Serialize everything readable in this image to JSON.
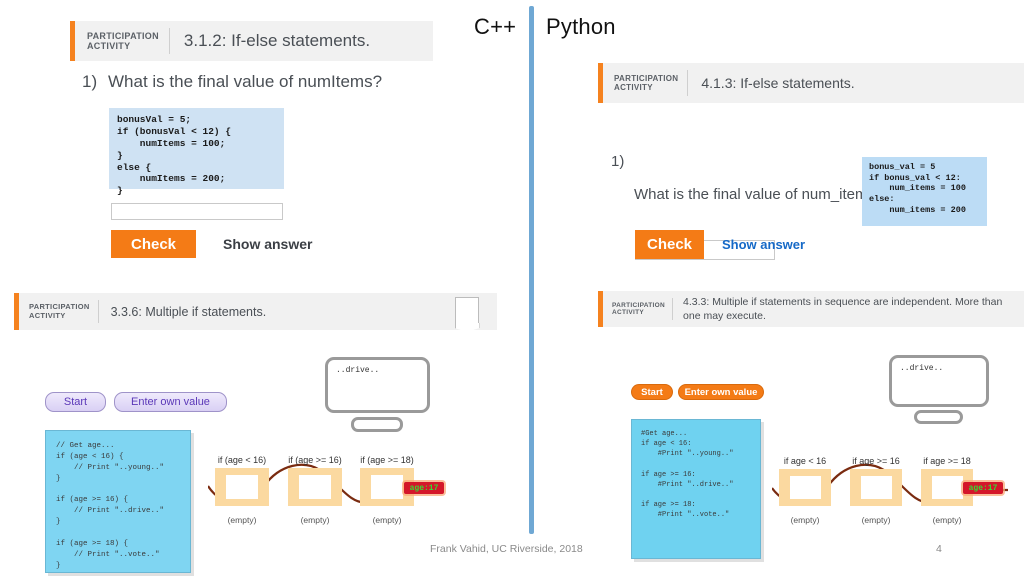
{
  "headings": {
    "left_lang": "C++",
    "right_lang": "Python"
  },
  "panel_cpp_ifelse": {
    "tag_line1": "PARTICIPATION",
    "tag_line2": "ACTIVITY",
    "title": "3.1.2: If-else statements.",
    "question_number": "1)",
    "question_text": "What is the final value of numItems?",
    "code": "bonusVal = 5;\nif (bonusVal < 12) {\n    numItems = 100;\n}\nelse {\n    numItems = 200;\n}",
    "answer_value": "",
    "answer_placeholder": "",
    "check_label": "Check",
    "show_answer_label": "Show answer"
  },
  "panel_py_ifelse": {
    "tag_line1": "PARTICIPATION",
    "tag_line2": "ACTIVITY",
    "title": "4.1.3: If-else statements.",
    "question_number": "1)",
    "question_text": "What is the final value of num_items?",
    "code": "bonus_val = 5\nif bonus_val < 12:\n    num_items = 100\nelse:\n    num_items = 200",
    "answer_value": "",
    "answer_placeholder": "",
    "check_label": "Check",
    "show_answer_label": "Show answer"
  },
  "panel_cpp_multi_if": {
    "tag_line1": "PARTICIPATION",
    "tag_line2": "ACTIVITY",
    "title": "3.3.6: Multiple if statements.",
    "start_label": "Start",
    "enter_value_label": "Enter own value",
    "code": "// Get age...\nif (age < 16) {\n    // Print \"..young..\"\n}\n\nif (age >= 16) {\n    // Print \"..drive..\"\n}\n\nif (age >= 18) {\n    // Print \"..vote..\"\n}",
    "monitor_output": "..drive..",
    "age_chip": "age:17",
    "gates": [
      {
        "label": "if (age < 16)",
        "sub": "(empty)"
      },
      {
        "label": "if (age >= 16)",
        "sub": "(empty)"
      },
      {
        "label": "if (age >= 18)",
        "sub": "(empty)"
      }
    ]
  },
  "panel_py_multi_if": {
    "tag_line1": "PARTICIPATION",
    "tag_line2": "ACTIVITY",
    "title": "4.3.3: Multiple if statements in sequence are independent. More than one may execute.",
    "start_label": "Start",
    "enter_value_label": "Enter own value",
    "code": "#Get age...\nif age < 16:\n    #Print \"..young..\"\n\nif age >= 16:\n    #Print \"..drive..\"\n\nif age >= 18:\n    #Print \"..vote..\"",
    "monitor_output": "..drive..",
    "age_chip": "age:17",
    "gates": [
      {
        "label": "if age < 16",
        "sub": "(empty)"
      },
      {
        "label": "if age >= 16",
        "sub": "(empty)"
      },
      {
        "label": "if age >= 18",
        "sub": "(empty)"
      }
    ]
  },
  "footer": {
    "credit": "Frank Vahid, UC Riverside, 2018",
    "page_number": "4"
  },
  "colors": {
    "accent_orange": "#f5821f",
    "divider_blue": "#6fa8d4",
    "code_blue": "#cfe2f3",
    "sim_sky": "#7fd5f2",
    "gate_tan": "#fbd9a0",
    "link_blue": "#1569c7"
  }
}
